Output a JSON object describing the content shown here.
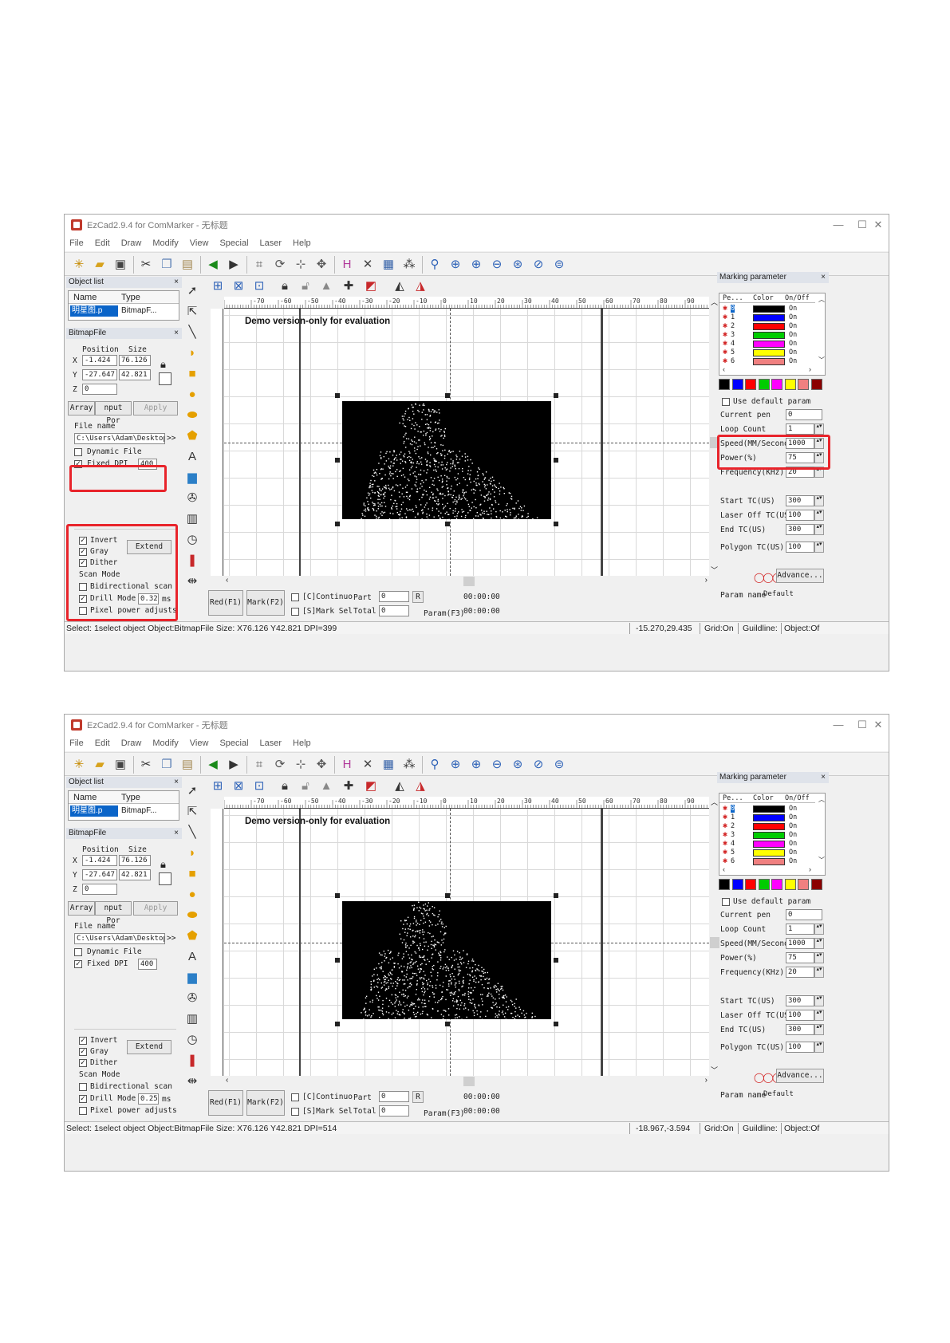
{
  "shots": [
    {
      "title_bar": {
        "title": "EzCad2.9.4 for ComMarker - 无标题",
        "minimize": "—",
        "maximize": "☐",
        "close": "✕"
      },
      "menu": [
        "File",
        "Edit",
        "Draw",
        "Modify",
        "View",
        "Special",
        "Laser",
        "Help"
      ],
      "object_list": {
        "title": "Object list",
        "close": "×",
        "col_name": "Name",
        "col_type": "Type",
        "row_name": "明星图.p",
        "row_type": "BitmapF..."
      },
      "bitmap": {
        "title": "BitmapFile",
        "close": "×",
        "position_label": "Position",
        "size_label": "Size",
        "x_label": "X",
        "y_label": "Y",
        "z_label": "Z",
        "x": "-1.424",
        "y": "-27.647",
        "z": "0",
        "size_x": "76.126",
        "size_y": "42.821",
        "array_btn": "Array",
        "input_btn": "nput Por",
        "apply_btn": "Apply",
        "file_name_label": "File name",
        "file_path": "C:\\Users\\Adam\\Desktop",
        "browse": ">>",
        "dynamic_file": "Dynamic File",
        "fixed_dpi": "Fixed DPI",
        "dpi": "400",
        "invert": "Invert",
        "gray": "Gray",
        "dither": "Dither",
        "extend": "Extend",
        "scan_mode": "Scan Mode",
        "bidirectional": "Bidirectional scan",
        "drill_mode": "Drill Mode",
        "drill_value": "0.32",
        "drill_unit": "ms",
        "pixel_power": "Pixel power adjusts"
      },
      "canvas": {
        "demo_text": "Demo version-only for evaluation",
        "ruler_ticks": [
          "-70",
          "-60",
          "-50",
          "-40",
          "-30",
          "-20",
          "-10",
          "0",
          "10",
          "20",
          "30",
          "40",
          "50",
          "60",
          "70",
          "80",
          "90"
        ]
      },
      "bottom": {
        "red": "Red(F1)",
        "mark": "Mark(F2)",
        "continuous": "[C]Continuo",
        "part_label": "Part",
        "part": "0",
        "r_btn": "R",
        "mark_sel": "[S]Mark Sel",
        "total_label": "Total",
        "total": "0",
        "time1": "00:00:00",
        "time2": "00:00:00",
        "param": "Param(F3)"
      },
      "marking": {
        "title": "Marking parameter",
        "close": "×",
        "col_pen": "Pe...",
        "col_color": "Color",
        "col_onoff": "On/Off",
        "pens": [
          {
            "n": "0",
            "color": "#000000",
            "state": "On"
          },
          {
            "n": "1",
            "color": "#0000ff",
            "state": "On"
          },
          {
            "n": "2",
            "color": "#ff0000",
            "state": "On"
          },
          {
            "n": "3",
            "color": "#00cc00",
            "state": "On"
          },
          {
            "n": "4",
            "color": "#ff00ff",
            "state": "On"
          },
          {
            "n": "5",
            "color": "#ffff00",
            "state": "On"
          },
          {
            "n": "6",
            "color": "#f08080",
            "state": "On"
          }
        ],
        "swatches": [
          "#000000",
          "#0000ff",
          "#ff0000",
          "#00cc00",
          "#ff00ff",
          "#ffff00",
          "#f08080",
          "#8b0000"
        ],
        "use_default": "Use default param",
        "current_pen_label": "Current pen",
        "current_pen": "0",
        "loop_label": "Loop Count",
        "loop": "1",
        "speed_label": "Speed(MM/Second",
        "speed": "1000",
        "power_label": "Power(%)",
        "power": "75",
        "freq_label": "Frequency(KHz)",
        "freq": "20",
        "start_tc_label": "Start TC(US)",
        "start_tc": "300",
        "laser_off_label": "Laser Off TC(US",
        "laser_off": "100",
        "end_tc_label": "End TC(US)",
        "end_tc": "300",
        "polygon_label": "Polygon TC(US)",
        "polygon": "100",
        "advance": "Advance...",
        "param_name_label": "Param name",
        "param_name": "Default"
      },
      "status": {
        "select": "Select: 1select object Object:BitmapFile Size: X76.126 Y42.821 DPI=399",
        "coords": "-15.270,29.435",
        "grid": "Grid:On",
        "guideline": "Guildline:",
        "object": "Object:Of"
      }
    },
    {
      "title_bar": {
        "title": "EzCad2.9.4 for ComMarker - 无标题",
        "minimize": "—",
        "maximize": "☐",
        "close": "✕"
      },
      "menu": [
        "File",
        "Edit",
        "Draw",
        "Modify",
        "View",
        "Special",
        "Laser",
        "Help"
      ],
      "object_list": {
        "title": "Object list",
        "close": "×",
        "col_name": "Name",
        "col_type": "Type",
        "row_name": "明星图.p",
        "row_type": "BitmapF..."
      },
      "bitmap": {
        "title": "BitmapFile",
        "close": "×",
        "position_label": "Position",
        "size_label": "Size",
        "x_label": "X",
        "y_label": "Y",
        "z_label": "Z",
        "x": "-1.424",
        "y": "-27.647",
        "z": "0",
        "size_x": "76.126",
        "size_y": "42.821",
        "array_btn": "Array",
        "input_btn": "nput Por",
        "apply_btn": "Apply",
        "file_name_label": "File name",
        "file_path": "C:\\Users\\Adam\\Desktop",
        "browse": ">>",
        "dynamic_file": "Dynamic File",
        "fixed_dpi": "Fixed DPI",
        "dpi": "400",
        "invert": "Invert",
        "gray": "Gray",
        "dither": "Dither",
        "extend": "Extend",
        "scan_mode": "Scan Mode",
        "bidirectional": "Bidirectional scan",
        "drill_mode": "Drill Mode",
        "drill_value": "0.25",
        "drill_unit": "ms",
        "pixel_power": "Pixel power adjusts"
      },
      "canvas": {
        "demo_text": "Demo version-only for evaluation",
        "ruler_ticks": [
          "-70",
          "-60",
          "-50",
          "-40",
          "-30",
          "-20",
          "-10",
          "0",
          "10",
          "20",
          "30",
          "40",
          "50",
          "60",
          "70",
          "80",
          "90"
        ]
      },
      "bottom": {
        "red": "Red(F1)",
        "mark": "Mark(F2)",
        "continuous": "[C]Continuo",
        "part_label": "Part",
        "part": "0",
        "r_btn": "R",
        "mark_sel": "[S]Mark Sel",
        "total_label": "Total",
        "total": "0",
        "time1": "00:00:00",
        "time2": "00:00:00",
        "param": "Param(F3)"
      },
      "marking": {
        "title": "Marking parameter",
        "close": "×",
        "col_pen": "Pe...",
        "col_color": "Color",
        "col_onoff": "On/Off",
        "pens": [
          {
            "n": "0",
            "color": "#000000",
            "state": "On"
          },
          {
            "n": "1",
            "color": "#0000ff",
            "state": "On"
          },
          {
            "n": "2",
            "color": "#ff0000",
            "state": "On"
          },
          {
            "n": "3",
            "color": "#00cc00",
            "state": "On"
          },
          {
            "n": "4",
            "color": "#ff00ff",
            "state": "On"
          },
          {
            "n": "5",
            "color": "#ffff00",
            "state": "On"
          },
          {
            "n": "6",
            "color": "#f08080",
            "state": "On"
          }
        ],
        "swatches": [
          "#000000",
          "#0000ff",
          "#ff0000",
          "#00cc00",
          "#ff00ff",
          "#ffff00",
          "#f08080",
          "#8b0000"
        ],
        "use_default": "Use default param",
        "current_pen_label": "Current pen",
        "current_pen": "0",
        "loop_label": "Loop Count",
        "loop": "1",
        "speed_label": "Speed(MM/Second",
        "speed": "1000",
        "power_label": "Power(%)",
        "power": "75",
        "freq_label": "Frequency(KHz)",
        "freq": "20",
        "start_tc_label": "Start TC(US)",
        "start_tc": "300",
        "laser_off_label": "Laser Off TC(US",
        "laser_off": "100",
        "end_tc_label": "End TC(US)",
        "end_tc": "300",
        "polygon_label": "Polygon TC(US)",
        "polygon": "100",
        "advance": "Advance...",
        "param_name_label": "Param name",
        "param_name": "Default"
      },
      "status": {
        "select": "Select: 1select object Object:BitmapFile Size: X76.126 Y42.821 DPI=514",
        "coords": "-18.967,-3.594",
        "grid": "Grid:On",
        "guideline": "Guildline:",
        "object": "Object:Of"
      }
    }
  ],
  "colors": {
    "highlight_box": "#e8242b",
    "selection": "#0a64c8"
  },
  "icons": [
    "new-file-icon",
    "open-folder-icon",
    "save-icon",
    "cut-icon",
    "copy-icon",
    "paste-icon",
    "back-icon",
    "forward-icon",
    "zoom-in-icon",
    "zoom-out-icon",
    "select-arrow-icon",
    "lock-icon"
  ]
}
